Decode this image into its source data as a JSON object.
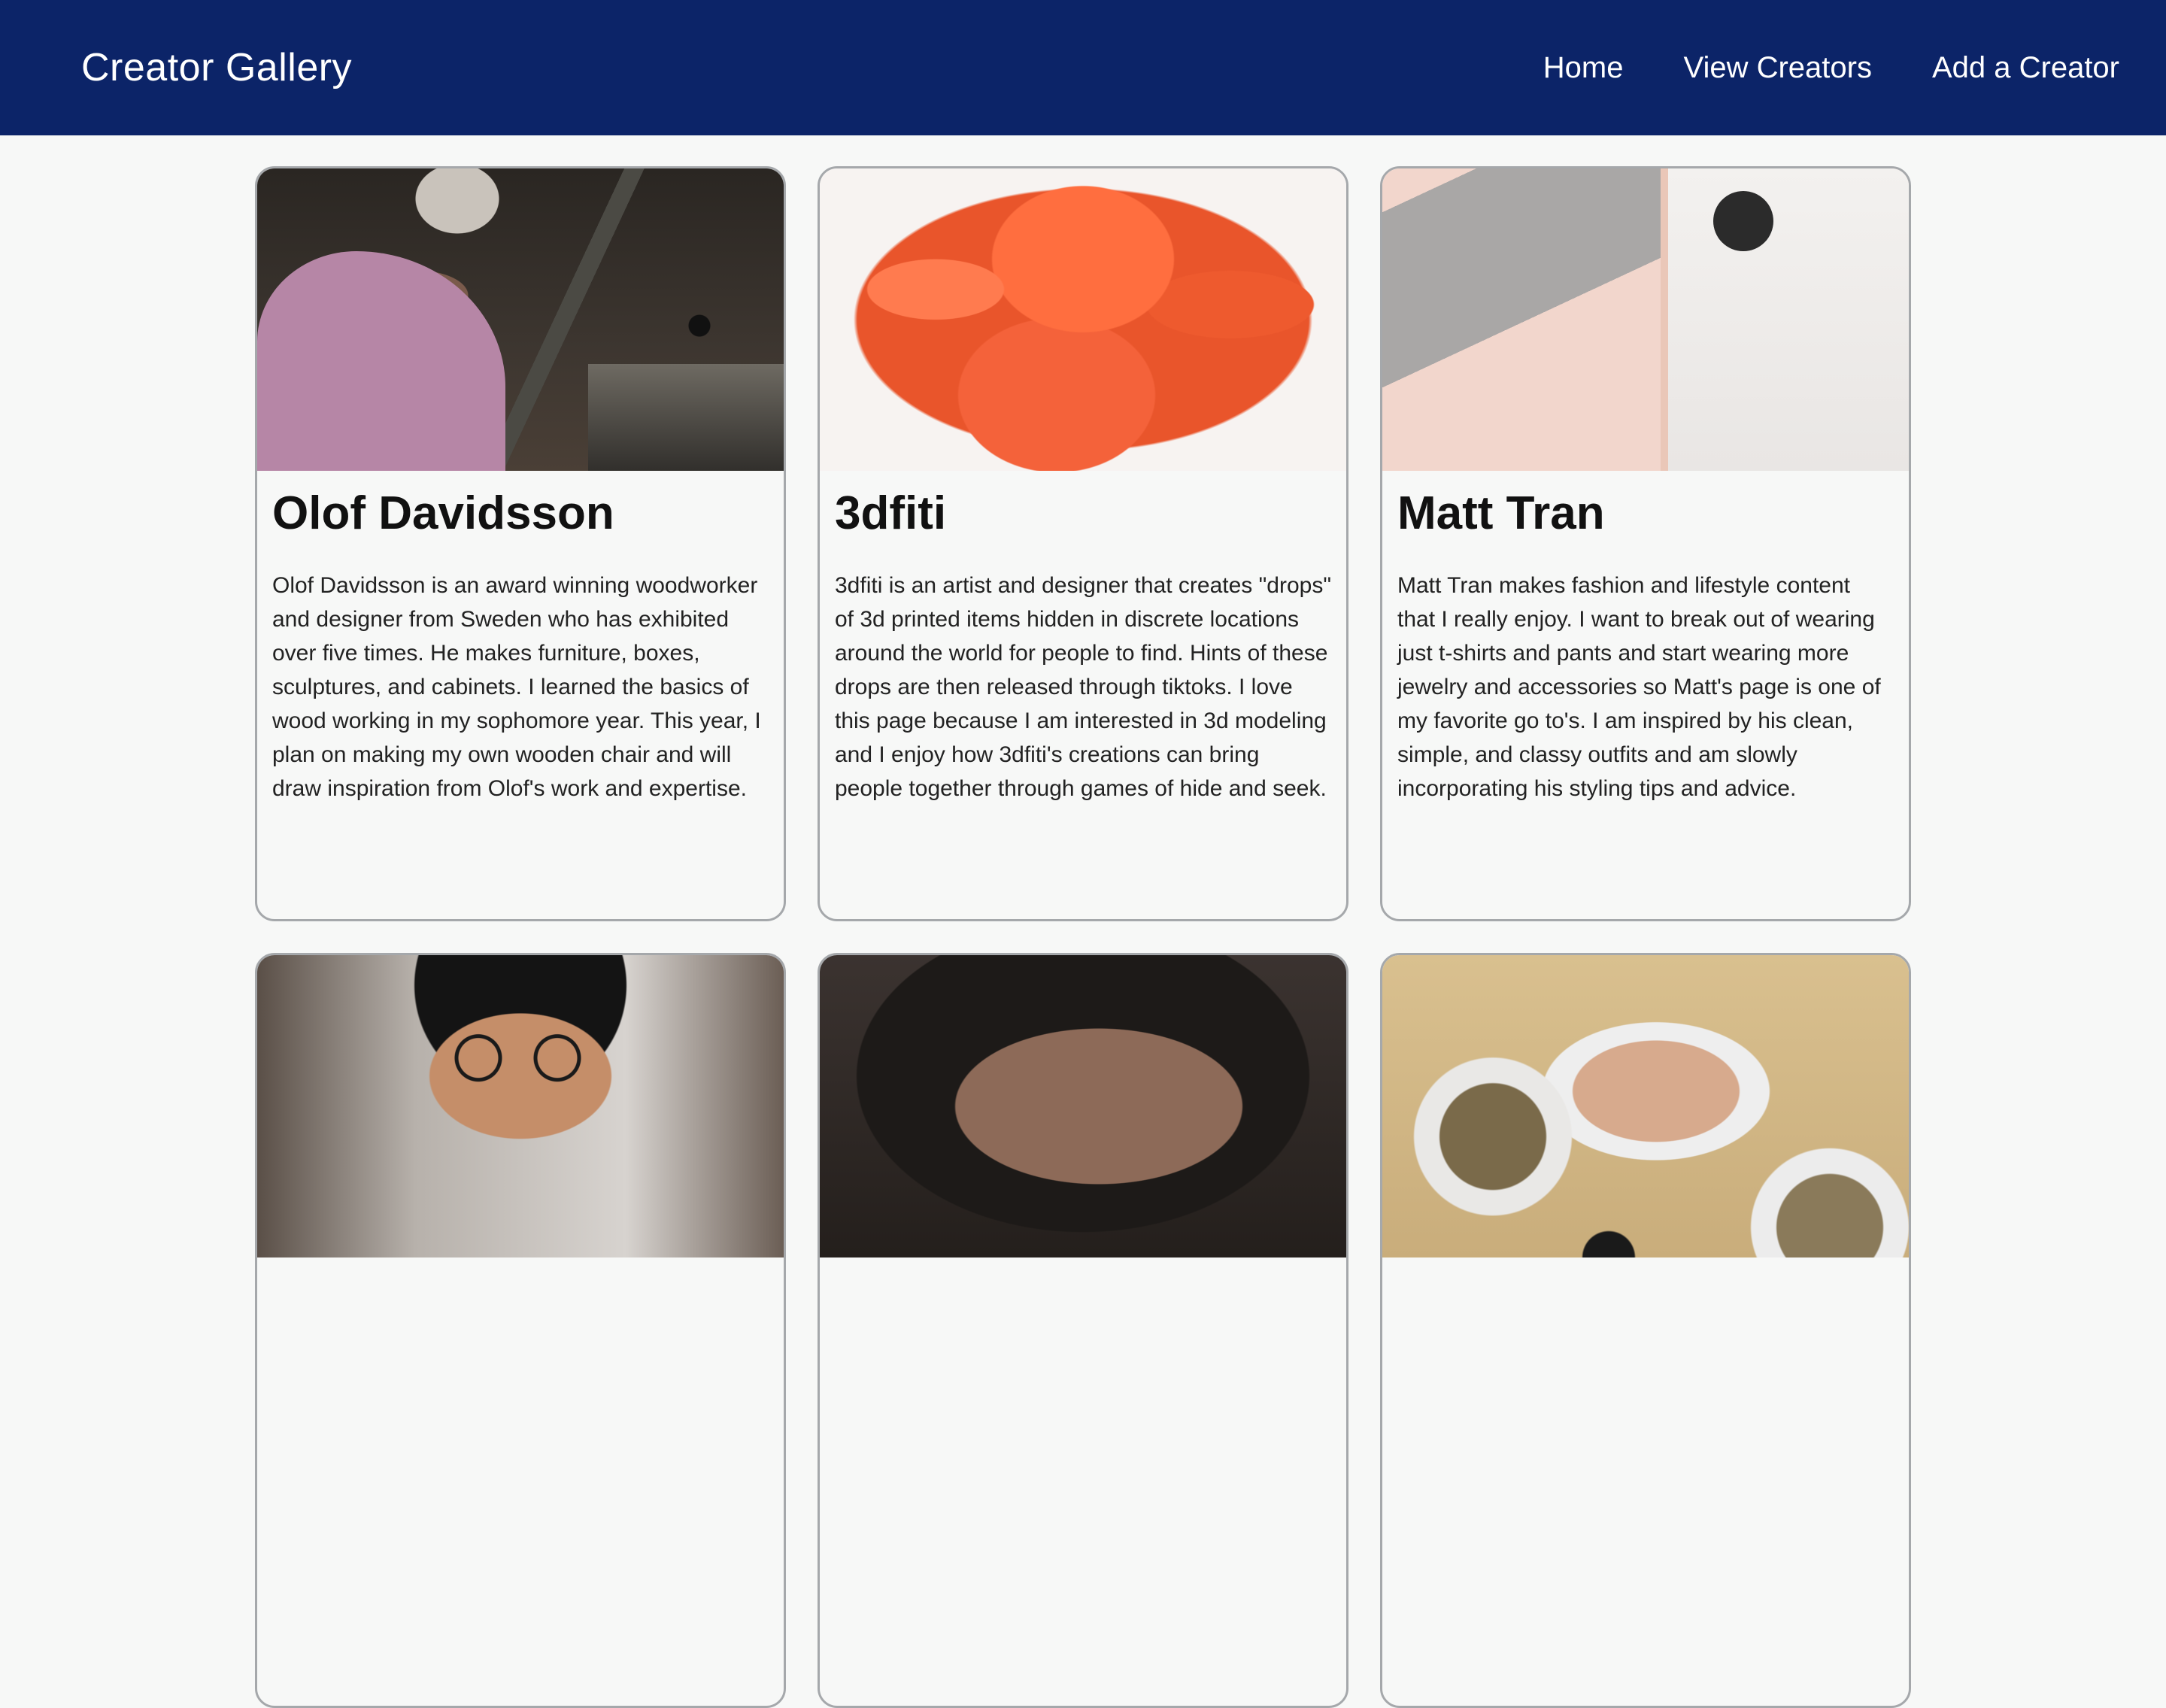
{
  "nav": {
    "brand": "Creator Gallery",
    "links": [
      "Home",
      "View Creators",
      "Add a Creator"
    ]
  },
  "creators": [
    {
      "name": "Olof Davidsson",
      "description": "Olof Davidsson is an award winning woodworker and designer from Sweden who has exhibited over five times. He makes furniture, boxes, sculptures, and cabinets. I learned the basics of wood working in my sophomore year. This year, I plan on making my own wooden chair and will draw inspiration from Olof's work and expertise."
    },
    {
      "name": "3dfiti",
      "description": "3dfiti is an artist and designer that creates \"drops\" of 3d printed items hidden in discrete locations around the world for people to find. Hints of these drops are then released through tiktoks. I love this page because I am interested in 3d modeling and I enjoy how 3dfiti's creations can bring people together through games of hide and seek."
    },
    {
      "name": "Matt Tran",
      "description": "Matt Tran makes fashion and lifestyle content that I really enjoy. I want to break out of wearing just t-shirts and pants and start wearing more jewelry and accessories so Matt's page is one of my favorite go to's. I am inspired by his clean, simple, and classy outfits and am slowly incorporating his styling tips and advice."
    },
    {
      "name": "",
      "description": ""
    },
    {
      "name": "",
      "description": ""
    },
    {
      "name": "",
      "description": ""
    }
  ]
}
